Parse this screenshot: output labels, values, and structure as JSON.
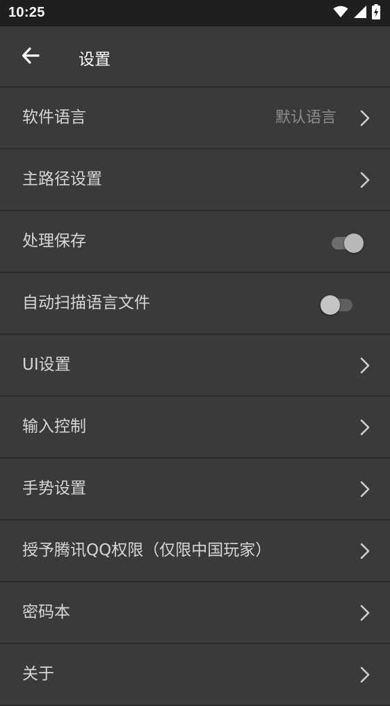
{
  "status_bar": {
    "time": "10:25",
    "icons": [
      "wifi-icon",
      "signal-icon",
      "battery-charging-icon"
    ]
  },
  "app_bar": {
    "title": "设置",
    "back_icon": "arrow-left-icon"
  },
  "settings": {
    "items": [
      {
        "label": "软件语言",
        "value": "默认语言",
        "control": "chevron"
      },
      {
        "label": "主路径设置",
        "control": "chevron"
      },
      {
        "label": "处理保存",
        "control": "toggle",
        "checked": true
      },
      {
        "label": "自动扫描语言文件",
        "control": "toggle",
        "checked": false
      },
      {
        "label": "UI设置",
        "control": "chevron"
      },
      {
        "label": "输入控制",
        "control": "chevron"
      },
      {
        "label": "手势设置",
        "control": "chevron"
      },
      {
        "label": "授予腾讯QQ权限（仅限中国玩家）",
        "control": "chevron"
      },
      {
        "label": "密码本",
        "control": "chevron"
      },
      {
        "label": "关于",
        "control": "chevron"
      }
    ]
  },
  "colors": {
    "background": "#3a3a3a",
    "status_bar": "#1f1f1f",
    "divider": "#2a2a2a",
    "text_primary": "#d6d6d6",
    "text_secondary": "#8c8c8c"
  }
}
